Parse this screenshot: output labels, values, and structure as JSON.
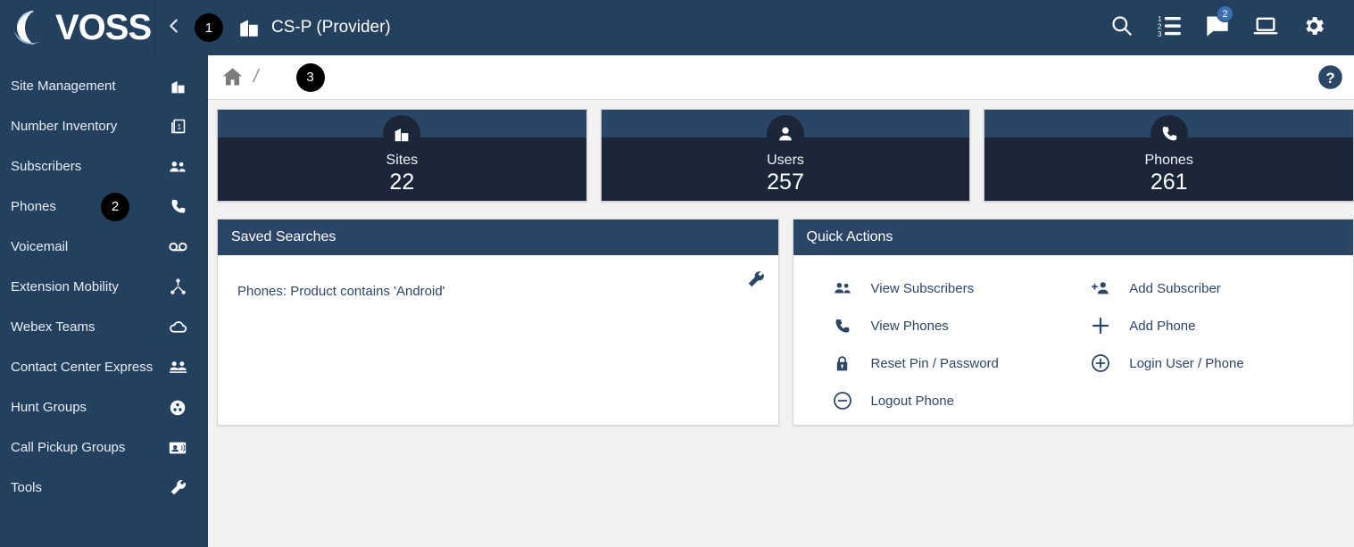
{
  "header": {
    "logo_text": "VOSS",
    "collapse_icon": "chevron-left-icon",
    "annotation_badge_1": "1",
    "context_icon": "building-icon",
    "context_title": "CS-P (Provider)",
    "actions": [
      {
        "name": "search-icon",
        "label": "Search",
        "badge": ""
      },
      {
        "name": "ordered-list-icon",
        "label": "Transactions",
        "badge": ""
      },
      {
        "name": "message-icon",
        "label": "Messages",
        "badge": "2"
      },
      {
        "name": "laptop-icon",
        "label": "Devices",
        "badge": ""
      },
      {
        "name": "gear-icon",
        "label": "Settings",
        "badge": ""
      }
    ]
  },
  "sidebar": {
    "items": [
      {
        "label": "Site Management",
        "icon": "building-icon",
        "badge": ""
      },
      {
        "label": "Number Inventory",
        "icon": "number-inventory-icon",
        "badge": ""
      },
      {
        "label": "Subscribers",
        "icon": "people-icon",
        "badge": ""
      },
      {
        "label": "Phones",
        "icon": "phone-icon",
        "badge": "2"
      },
      {
        "label": "Voicemail",
        "icon": "voicemail-icon",
        "badge": ""
      },
      {
        "label": "Extension Mobility",
        "icon": "extension-mobility-icon",
        "badge": ""
      },
      {
        "label": "Webex Teams",
        "icon": "cloud-icon",
        "badge": ""
      },
      {
        "label": "Contact Center Express",
        "icon": "contact-center-icon",
        "badge": ""
      },
      {
        "label": "Hunt Groups",
        "icon": "hunt-group-icon",
        "badge": ""
      },
      {
        "label": "Call Pickup Groups",
        "icon": "call-pickup-icon",
        "badge": ""
      },
      {
        "label": "Tools",
        "icon": "wrench-icon",
        "badge": ""
      }
    ]
  },
  "breadcrumb": {
    "home_icon": "home-icon",
    "separator": "/",
    "annotation_badge_3": "3",
    "help_icon": "help-icon"
  },
  "stats": [
    {
      "label": "Sites",
      "value": "22",
      "icon": "building-icon"
    },
    {
      "label": "Users",
      "value": "257",
      "icon": "person-icon"
    },
    {
      "label": "Phones",
      "value": "261",
      "icon": "phone-icon"
    }
  ],
  "saved_searches": {
    "title": "Saved Searches",
    "items": [
      {
        "text": "Phones: Product contains 'Android'"
      }
    ],
    "tool_icon": "wrench-icon"
  },
  "quick_actions": {
    "title": "Quick Actions",
    "items": [
      {
        "label": "View Subscribers",
        "icon": "people-icon"
      },
      {
        "label": "Add Subscriber",
        "icon": "person-add-icon"
      },
      {
        "label": "View Phones",
        "icon": "phone-icon"
      },
      {
        "label": "Add Phone",
        "icon": "plus-icon"
      },
      {
        "label": "Reset Pin / Password",
        "icon": "lock-icon"
      },
      {
        "label": "Login User / Phone",
        "icon": "plus-circle-icon"
      },
      {
        "label": "Logout Phone",
        "icon": "minus-circle-icon"
      }
    ]
  },
  "colors": {
    "navy": "#24405f",
    "card_top": "#2a4566",
    "card_body": "#1b2738",
    "page_bg": "#f2f2f2",
    "badge_blue": "#3c6fb1",
    "annotation_black": "#000000"
  }
}
